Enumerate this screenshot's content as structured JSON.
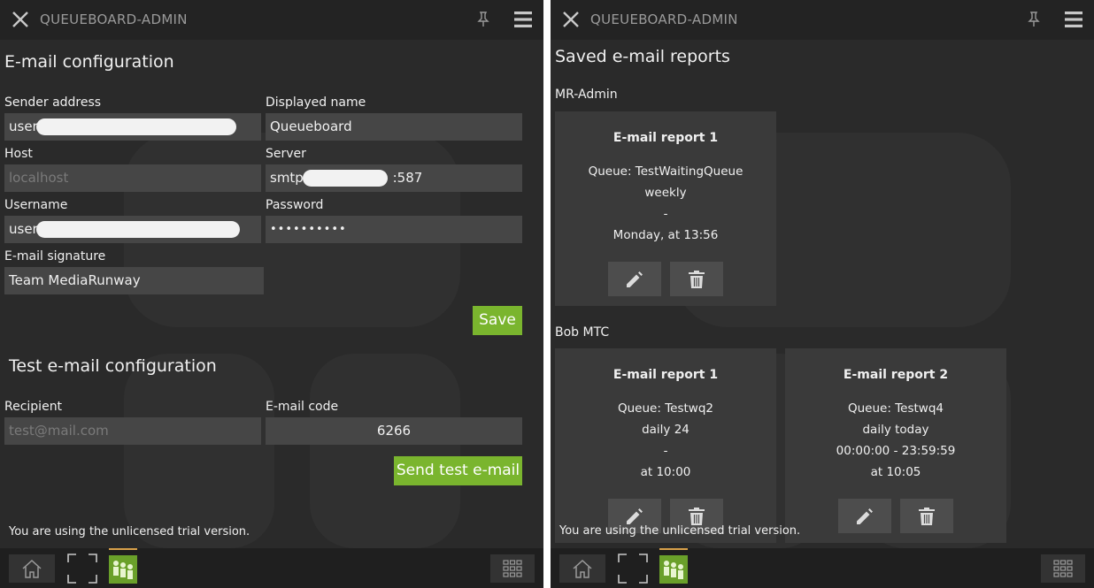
{
  "app": {
    "title": "QUEUEBOARD-ADMIN"
  },
  "left": {
    "heading": "E-mail configuration",
    "sender_label": "Sender address",
    "sender_value": "user",
    "displayed_name_label": "Displayed name",
    "displayed_name_value": "Queueboard",
    "host_label": "Host",
    "host_placeholder": "localhost",
    "server_label": "Server",
    "server_prefix": "smtp.",
    "server_suffix": ":587",
    "username_label": "Username",
    "username_value": "user",
    "password_label": "Password",
    "password_value": "••••••••••",
    "signature_label": "E-mail signature",
    "signature_value": "Team MediaRunway",
    "save_label": "Save",
    "test_heading": "Test e-mail configuration",
    "recipient_label": "Recipient",
    "recipient_placeholder": "test@mail.com",
    "code_label": "E-mail code",
    "code_value": "6266",
    "send_label": "Send test e-mail",
    "trial": "You are using the unlicensed trial version."
  },
  "right": {
    "heading": "Saved e-mail reports",
    "trial": "You are using the unlicensed trial version.",
    "groups": [
      {
        "name": "MR-Admin",
        "reports": [
          {
            "title": "E-mail report 1",
            "lines": [
              "Queue: TestWaitingQueue",
              "weekly",
              "-",
              "Monday, at 13:56"
            ]
          }
        ]
      },
      {
        "name": "Bob MTC",
        "reports": [
          {
            "title": "E-mail report 1",
            "lines": [
              "Queue: Testwq2",
              "daily 24",
              "-",
              "at 10:00"
            ]
          },
          {
            "title": "E-mail report 2",
            "lines": [
              "Queue: Testwq4",
              "daily today",
              "00:00:00 - 23:59:59",
              "at 10:05"
            ]
          }
        ]
      }
    ]
  },
  "icons": {
    "close": "close-icon",
    "pin": "pin-icon",
    "menu": "hamburger-menu-icon",
    "home": "home-icon",
    "fullscreen": "fullscreen-icon",
    "grid": "grid-icon",
    "edit": "pencil-icon",
    "delete": "trash-icon"
  },
  "colors": {
    "accent": "#7ab52e",
    "background": "#2a2a2a",
    "field": "#464646",
    "card": "#3a3a3a"
  }
}
